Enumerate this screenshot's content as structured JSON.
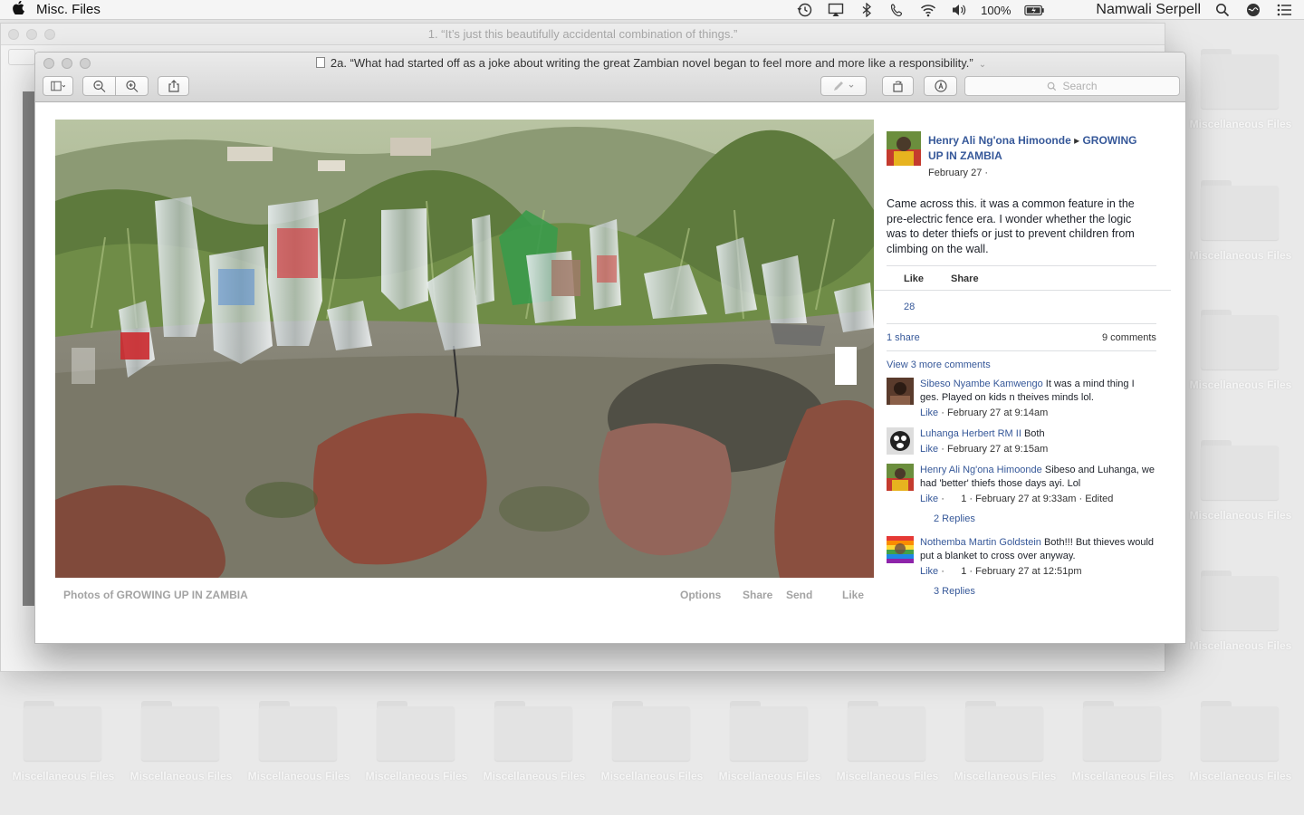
{
  "menubar": {
    "apple": "",
    "app_name": "Misc. Files",
    "battery": "100%",
    "user": "Namwali Serpell"
  },
  "desktop": {
    "folder_label": "Miscellaneous Files"
  },
  "back_window": {
    "title": "1. “It’s just this beautifully accidental combination of things.”"
  },
  "window": {
    "title": "2a. “What had started off as a joke about writing the great Zambian novel began to feel more and more like a responsibility.”",
    "search_placeholder": "Search"
  },
  "photo_footer": {
    "title": "Photos of GROWING UP IN ZAMBIA",
    "options": "Options",
    "share": "Share",
    "send": "Send",
    "like": "Like"
  },
  "post": {
    "author": "Henry Ali Ng'ona Himoonde",
    "group": "GROWING UP IN ZAMBIA",
    "date": "February 27 ·",
    "text": "Came across this. it was a common feature in the pre-electric fence era. I wonder whether the logic was to deter thiefs or just to prevent children from climbing on the wall.",
    "like_label": "Like",
    "share_label": "Share",
    "likes_count": "28",
    "shares": "1 share",
    "comments_count": "9 comments",
    "view_more": "View 3 more comments"
  },
  "comments": [
    {
      "name": "Sibeso Nyambe Kamwengo",
      "text": " It was a mind thing I ges. Played on kids n theives minds lol.",
      "like": "Like",
      "meta": " · February 27 at 9:14am"
    },
    {
      "name": "Luhanga Herbert RM II",
      "text": " Both",
      "like": "Like",
      "meta": " · February 27 at 9:15am"
    },
    {
      "name": "Henry Ali Ng'ona Himoonde",
      "text": " Sibeso and Luhanga, we had 'better' thiefs those days ayi. Lol",
      "like": "Like",
      "meta": " ·      1 · February 27 at 9:33am · Edited",
      "replies": "2 Replies"
    },
    {
      "name": "Nothemba Martin Goldstein",
      "text": " Both!!! But thieves would put a blanket to cross over anyway.",
      "like": "Like",
      "meta": " ·      1 · February 27 at 12:51pm",
      "replies": "3 Replies"
    }
  ]
}
